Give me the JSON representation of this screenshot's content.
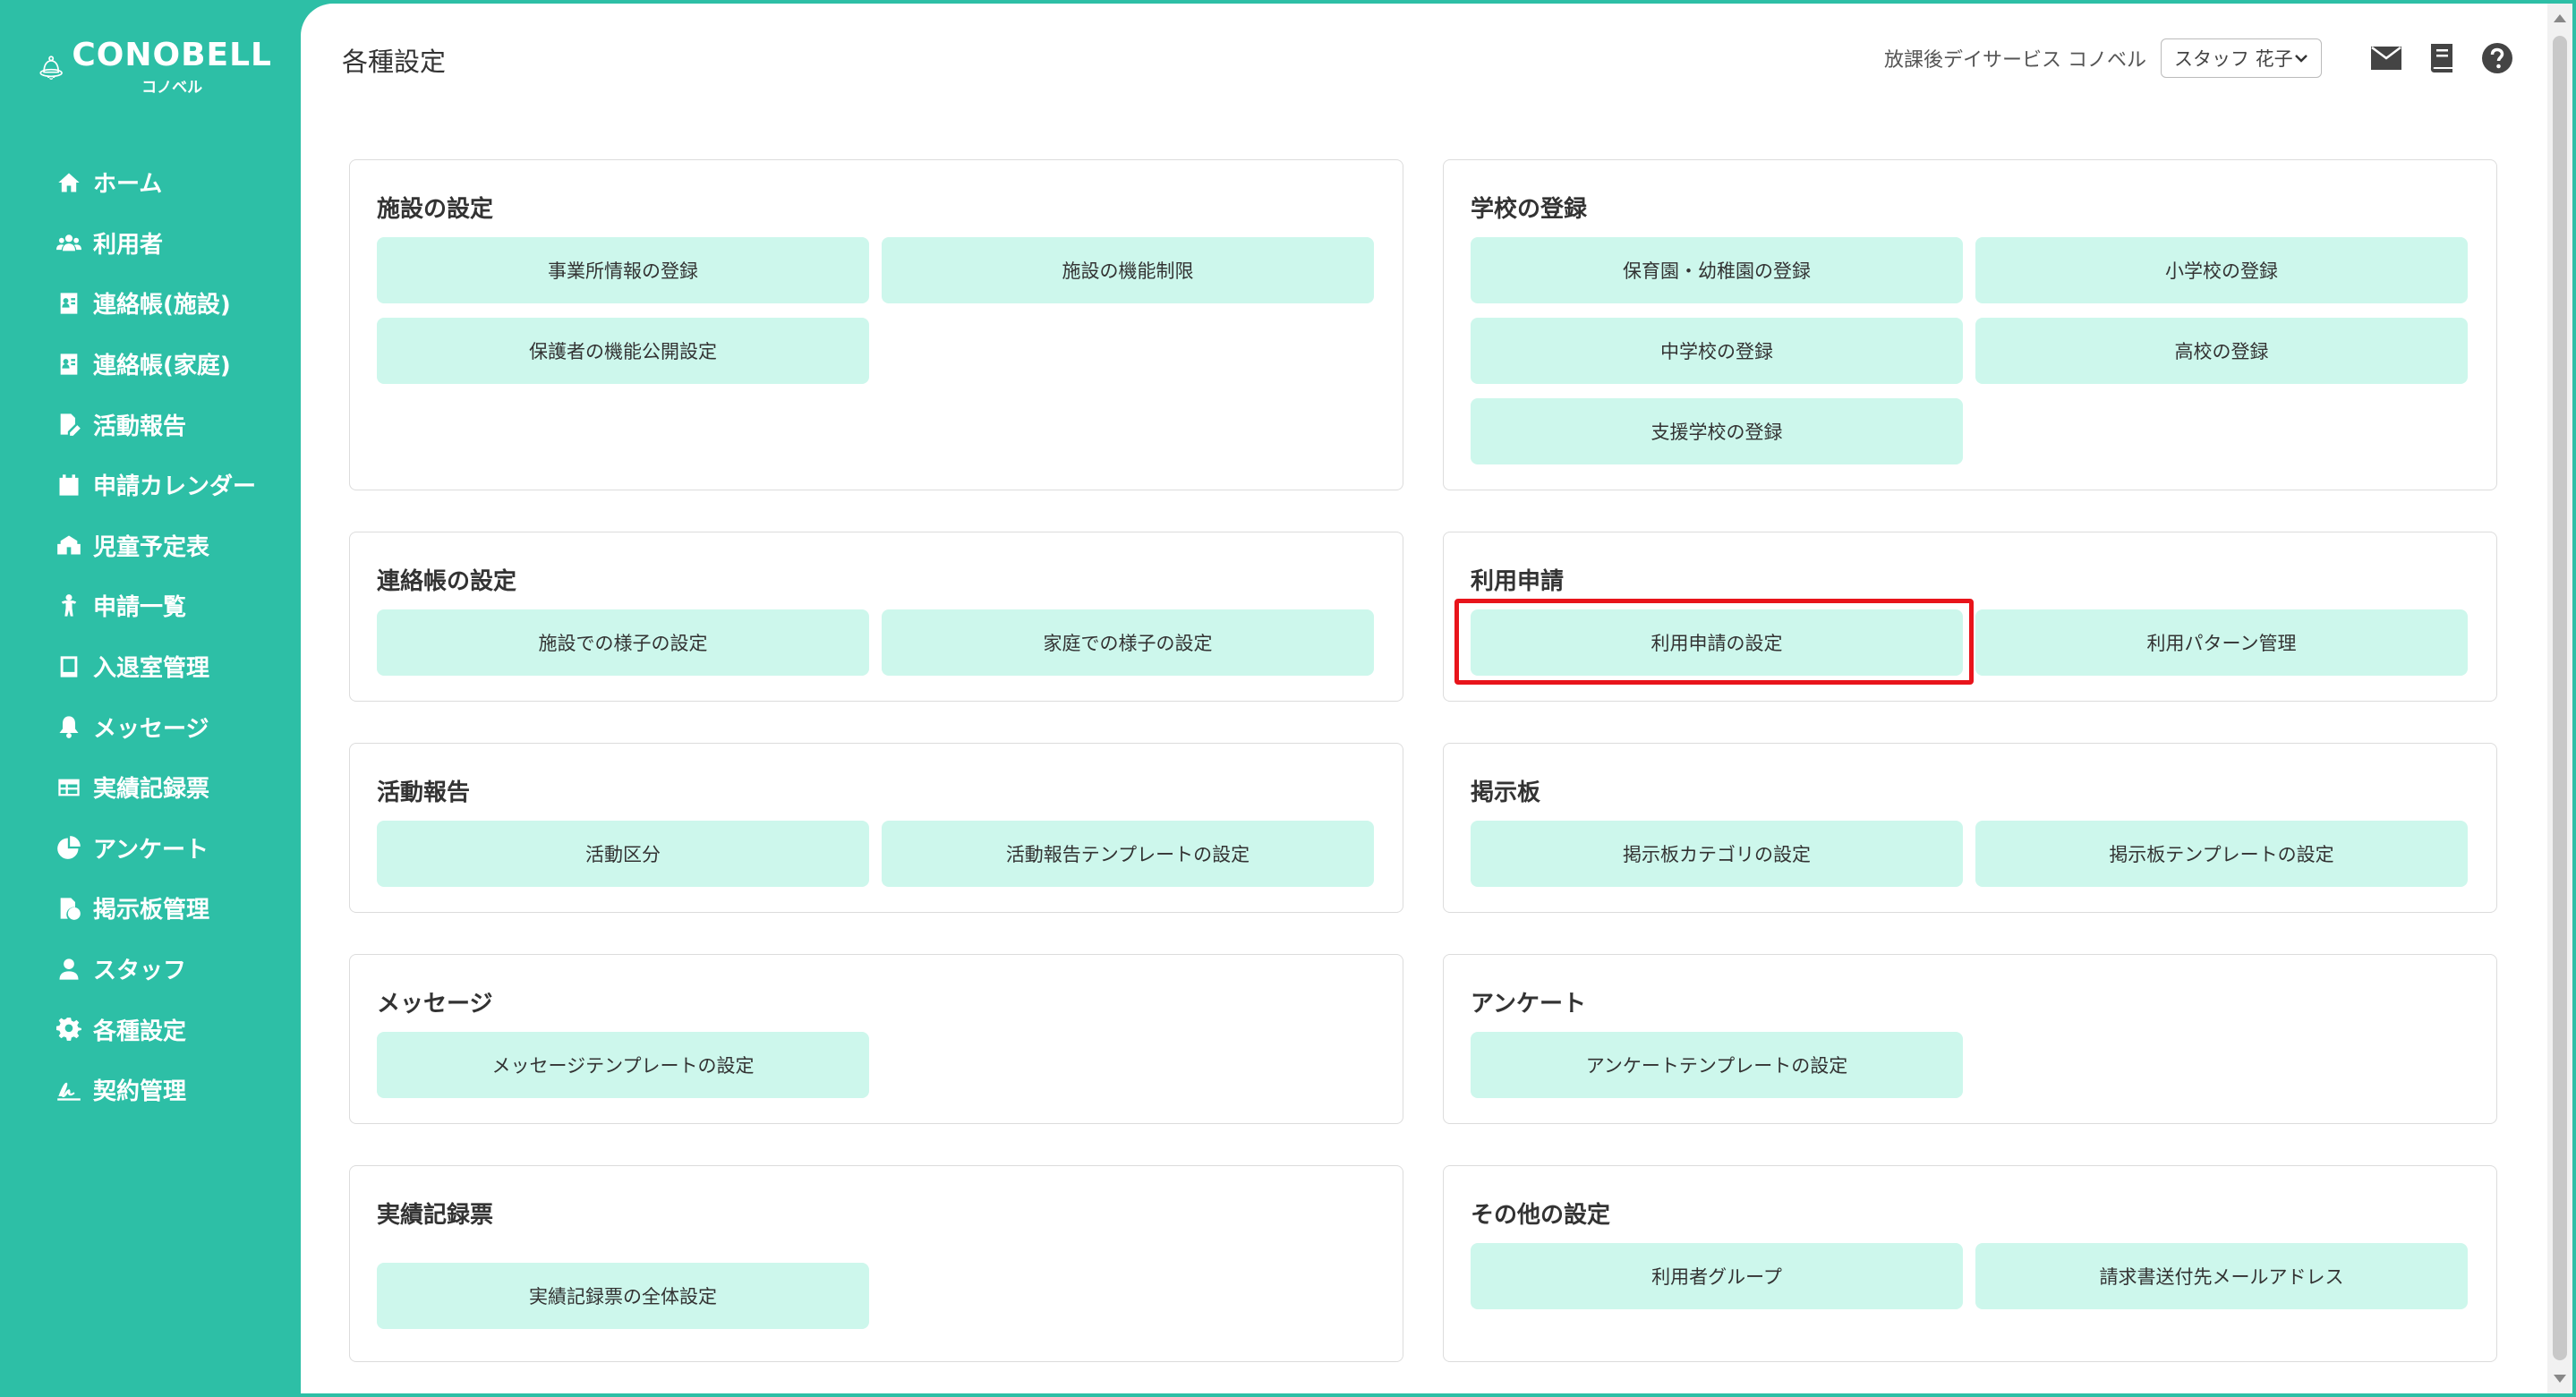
{
  "app": {
    "brand": "CONOBELL",
    "brand_sub": "コノベル",
    "page_title": "各種設定",
    "facility_name": "放課後デイサービス コノベル",
    "staff_name": "スタッフ 花子",
    "accent_color": "#2dbfa6",
    "button_color": "#cdf7ec",
    "highlight_color": "#e8141b"
  },
  "sidebar": {
    "items": [
      {
        "label": "ホーム",
        "icon": "home-icon"
      },
      {
        "label": "利用者",
        "icon": "users-icon"
      },
      {
        "label": "連絡帳(施設)",
        "icon": "contact-book-icon"
      },
      {
        "label": "連絡帳(家庭)",
        "icon": "contact-book-icon"
      },
      {
        "label": "活動報告",
        "icon": "file-edit-icon"
      },
      {
        "label": "申請カレンダー",
        "icon": "calendar-icon"
      },
      {
        "label": "児童予定表",
        "icon": "school-icon"
      },
      {
        "label": "申請一覧",
        "icon": "child-icon"
      },
      {
        "label": "入退室管理",
        "icon": "tablet-icon"
      },
      {
        "label": "メッセージ",
        "icon": "bell-icon"
      },
      {
        "label": "実績記録票",
        "icon": "table-icon"
      },
      {
        "label": "アンケート",
        "icon": "pie-chart-icon"
      },
      {
        "label": "掲示板管理",
        "icon": "file-clock-icon"
      },
      {
        "label": "スタッフ",
        "icon": "user-icon"
      },
      {
        "label": "各種設定",
        "icon": "gear-icon"
      },
      {
        "label": "契約管理",
        "icon": "signature-icon"
      }
    ]
  },
  "cards": {
    "facility": {
      "title": "施設の設定",
      "buttons": [
        "事業所情報の登録",
        "施設の機能制限",
        "保護者の機能公開設定"
      ]
    },
    "school": {
      "title": "学校の登録",
      "buttons": [
        "保育園・幼稚園の登録",
        "小学校の登録",
        "中学校の登録",
        "高校の登録",
        "支援学校の登録"
      ]
    },
    "contact": {
      "title": "連絡帳の設定",
      "buttons": [
        "施設での様子の設定",
        "家庭での様子の設定"
      ]
    },
    "usage": {
      "title": "利用申請",
      "buttons": [
        "利用申請の設定",
        "利用パターン管理"
      ]
    },
    "activity": {
      "title": "活動報告",
      "buttons": [
        "活動区分",
        "活動報告テンプレートの設定"
      ]
    },
    "board": {
      "title": "掲示板",
      "buttons": [
        "掲示板カテゴリの設定",
        "掲示板テンプレートの設定"
      ]
    },
    "message": {
      "title": "メッセージ",
      "buttons": [
        "メッセージテンプレートの設定"
      ]
    },
    "survey": {
      "title": "アンケート",
      "buttons": [
        "アンケートテンプレートの設定"
      ]
    },
    "record": {
      "title": "実績記録票",
      "buttons": [
        "実績記録票の全体設定"
      ]
    },
    "other": {
      "title": "その他の設定",
      "buttons": [
        "利用者グループ",
        "請求書送付先メールアドレス"
      ]
    }
  }
}
